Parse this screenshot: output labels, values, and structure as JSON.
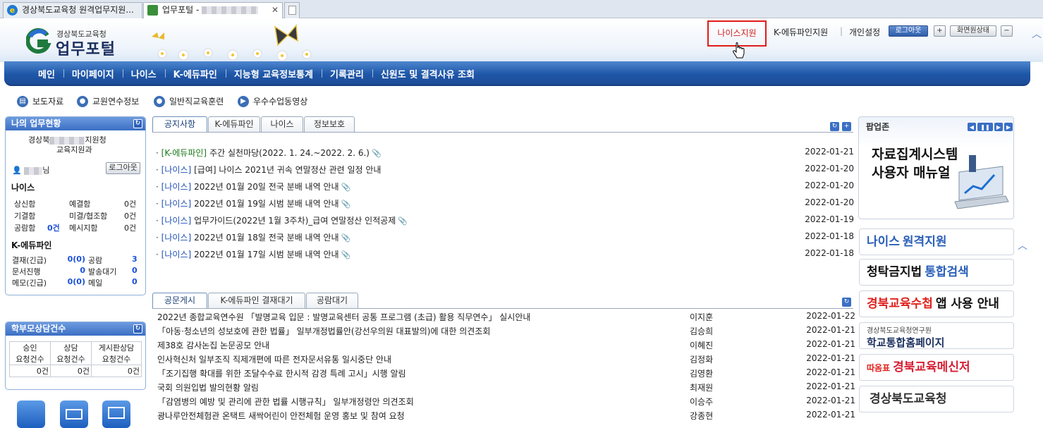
{
  "browser": {
    "tab1_title": "경상북도교육청 원격업무지원...",
    "tab2_title": "업무포털 -"
  },
  "header": {
    "logo_sub": "경상북도교육청",
    "logo_main": "업무포털",
    "util": {
      "neis_support": "나이스지원",
      "kedu_support": "K-에듀파인지원",
      "settings": "개인설정",
      "logout": "로그아웃",
      "plus": "+",
      "screen_state": "화면원상태",
      "minus": "−"
    }
  },
  "nav": [
    "메인",
    "마이페이지",
    "나이스",
    "K-에듀파인",
    "지능형 교육정보통계",
    "기록관리",
    "신원도 및 결격사유 조회"
  ],
  "quicklinks": [
    "보도자료",
    "교원연수정보",
    "일반직교육훈련",
    "우수수업동영상"
  ],
  "left": {
    "status_title": "나의 업무현황",
    "org_line1a": "경상북",
    "org_line1b": "지원청",
    "org_line2": "교육지원과",
    "user_suffix": "님",
    "logout": "로그아웃",
    "neis_title": "나이스",
    "neis_rows": [
      [
        "상신함",
        "",
        "예결함",
        "0건"
      ],
      [
        "기결함",
        "",
        "미결/협조함",
        "0건"
      ],
      [
        "공람함",
        "0건",
        "메시지함",
        "0건"
      ]
    ],
    "kedu_title": "K-에듀파인",
    "kedu_rows": [
      [
        "결재(긴급)",
        "0(0)",
        "공람",
        "3"
      ],
      [
        "문서진행",
        "0",
        "발송대기",
        "0"
      ],
      [
        "메모(긴급)",
        "0(0)",
        "메일",
        "0"
      ]
    ],
    "consult_title": "학부모상담건수",
    "consult_headers": [
      [
        "승인",
        "요청건수"
      ],
      [
        "상담",
        "요청건수"
      ],
      [
        "게시판상담",
        "요청건수"
      ]
    ],
    "consult_values": [
      "0건",
      "0건",
      "0건"
    ]
  },
  "notice": {
    "tabs": [
      "공지사항",
      "K-에듀파인",
      "나이스",
      "정보보호"
    ],
    "items": [
      {
        "cat": "[K-에듀파인]",
        "title": "주간 실천마당(2022. 1. 24.~2022. 2. 6.)",
        "clip": "📎",
        "date": "2022-01-21"
      },
      {
        "cat": "[나이스]",
        "title": "[급여] 나이스 2021년 귀속 연말정산 관련 일정 안내",
        "clip": "",
        "date": "2022-01-20"
      },
      {
        "cat": "[나이스]",
        "title": "2022년 01월 20일 전국 분배 내역 안내",
        "clip": "📎",
        "date": "2022-01-20"
      },
      {
        "cat": "[나이스]",
        "title": "2022년 01월 19일 시범 분배 내역 안내",
        "clip": "📎",
        "date": "2022-01-20"
      },
      {
        "cat": "[나이스]",
        "title": "업무가이드(2022년 1월 3주차)_급여 연말정산 인적공제",
        "clip": "📎",
        "date": "2022-01-19"
      },
      {
        "cat": "[나이스]",
        "title": "2022년 01월 18일 전국 분배 내역 안내",
        "clip": "📎",
        "date": "2022-01-18"
      },
      {
        "cat": "[나이스]",
        "title": "2022년 01월 17일 시범 분배 내역 안내",
        "clip": "📎",
        "date": "2022-01-18"
      }
    ]
  },
  "docs": {
    "tabs": [
      "공문게시",
      "K-에듀파인 결재대기",
      "공람대기"
    ],
    "items": [
      {
        "title": "2022년 종합교육연수원 「발명교육 입문 : 발명교육센터 공통 프로그램 (초급) 활용 직무연수」 실시안내",
        "who": "이지훈",
        "date": "2022-01-22"
      },
      {
        "title": "「아동·청소년의 성보호에 관한 법률」 일부개정법률안(강선우의원 대표발의)에 대한 의견조회",
        "who": "김승희",
        "date": "2022-01-21"
      },
      {
        "title": "제38호 감사논집 논문공모 안내",
        "who": "이혜진",
        "date": "2022-01-21"
      },
      {
        "title": "인사혁신처 일부조직 직제개편에 따른 전자문서유통 일시중단 안내",
        "who": "김정화",
        "date": "2022-01-21"
      },
      {
        "title": "「조기집행 확대를 위한 조달수수료 한시적 감경 특례 고시」시행 알림",
        "who": "김영환",
        "date": "2022-01-21"
      },
      {
        "title": "국회 의원입법 발의현황 알림",
        "who": "최재원",
        "date": "2022-01-21"
      },
      {
        "title": "「감염병의 예방 및 관리에 관한 법률 시행규칙」 일부개정령안 의견조회",
        "who": "이승주",
        "date": "2022-01-21"
      },
      {
        "title": "광나루안전체험관 온택트 새싹어린이 안전체험 운영 홍보 및 참여 요청",
        "who": "강종현",
        "date": "2022-01-21"
      }
    ]
  },
  "popup": {
    "title": "팝업존",
    "banner_line1": "자료집계시스템",
    "banner_line2": "사용자 매뉴얼"
  },
  "banners": [
    {
      "a": "나이스",
      "b": "원격지원",
      "color_a": "#2a5fb8",
      "color_b": "#2a5fb8"
    },
    {
      "a": "청탁금지법",
      "b": "통합검색",
      "color_a": "#111111",
      "color_b": "#2a5fb8"
    },
    {
      "a": "경북교육수첩",
      "b": "앱 사용 안내",
      "color_a": "#e0221d",
      "color_b": "#111111"
    },
    {
      "a": "경상북도교육청연구원",
      "b": "학교통합홈페이지",
      "color_a": "#444444",
      "color_b": "#1b2f5e"
    },
    {
      "a": "따옴표",
      "b": "경북교육메신저",
      "color_a": "#e0221d",
      "color_b": "#d61f32"
    },
    {
      "a": "",
      "b": "경상북도교육청",
      "color_a": "#000000",
      "color_b": "#333333"
    }
  ],
  "colors": {
    "nav": "#1f57a8",
    "accent_red": "#e01b1b",
    "panel_head": "#3b6fc4",
    "date_green": "#1a7a1a"
  }
}
